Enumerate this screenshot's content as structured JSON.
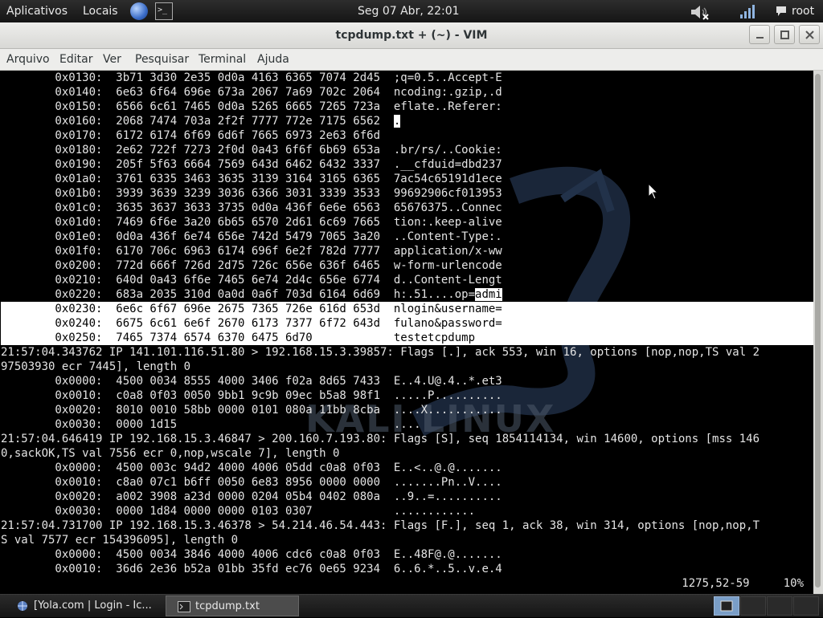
{
  "top_panel": {
    "applications": "Aplicativos",
    "places": "Locais",
    "clock": "Seg 07 Abr, 22:01",
    "user": "root",
    "launchers": [
      {
        "icon": "globe-icon"
      },
      {
        "icon": "terminal-icon"
      }
    ]
  },
  "window": {
    "title": "tcpdump.txt + (~) - VIM"
  },
  "menu": [
    "Arquivo",
    "Editar",
    "Ver",
    "Pesquisar",
    "Terminal",
    "Ajuda"
  ],
  "terminal": {
    "lines": [
      [
        {
          "t": "        0x0130:  3b71 3d30 2e35 0d0a 4163 6365 7074 2d45  ;q=0.5..Accept-E"
        }
      ],
      [
        {
          "t": "        0x0140:  6e63 6f64 696e 673a 2067 7a69 702c 2064  ncoding:.gzip,.d"
        }
      ],
      [
        {
          "t": "        0x0150:  6566 6c61 7465 0d0a 5265 6665 7265 723a  eflate..Referer:"
        }
      ],
      [
        {
          "t": "        0x0160:  2068 7474 703a 2f2f 7777 772e 7175 6562  "
        },
        {
          "t": ".",
          "c": "cursor"
        }
      ],
      [
        {
          "t": "        0x0170:  6172 6174 6f69 6d6f 7665 6973 2e63 6f6d"
        }
      ],
      [
        {
          "t": "        0x0180:  2e62 722f 7273 2f0d 0a43 6f6f 6b69 653a  .br/rs/..Cookie:"
        }
      ],
      [
        {
          "t": "        0x0190:  205f 5f63 6664 7569 643d 6462 6432 3337  .__cfduid=dbd237"
        }
      ],
      [
        {
          "t": "        0x01a0:  3761 6335 3463 3635 3139 3164 3165 6365  7ac54c65191d1ece"
        }
      ],
      [
        {
          "t": "        0x01b0:  3939 3639 3239 3036 6366 3031 3339 3533  99692906cf013953"
        }
      ],
      [
        {
          "t": "        0x01c0:  3635 3637 3633 3735 0d0a 436f 6e6e 6563  65676375..Connec"
        }
      ],
      [
        {
          "t": "        0x01d0:  7469 6f6e 3a20 6b65 6570 2d61 6c69 7665  tion:.keep-alive"
        }
      ],
      [
        {
          "t": "        0x01e0:  0d0a 436f 6e74 656e 742d 5479 7065 3a20  ..Content-Type:."
        }
      ],
      [
        {
          "t": "        0x01f0:  6170 706c 6963 6174 696f 6e2f 782d 7777  application/x-ww"
        }
      ],
      [
        {
          "t": "        0x0200:  772d 666f 726d 2d75 726c 656e 636f 6465  w-form-urlencode"
        }
      ],
      [
        {
          "t": "        0x0210:  640d 0a43 6f6e 7465 6e74 2d4c 656e 6774  d..Content-Lengt"
        }
      ],
      [
        {
          "t": "        0x0220:  683a 2035 310d 0a0d 0a6f 703d 6164 6d69  h:.51....op="
        },
        {
          "t": "admi",
          "c": "seg-hl"
        }
      ],
      [
        {
          "t": "        0x0230:  6e6c 6f67 696e 2675 7365 726e 616d 653d  nlogin&username="
        }
      ],
      [
        {
          "t": "        0x0240:  6675 6c61 6e6f 2670 6173 7377 6f72 643d  fulano&password="
        }
      ],
      [
        {
          "t": "        0x0250:  7465 7374 6574 6370 6475 6d70            testetcpdump"
        }
      ],
      [
        {
          "t": "21:57:04.343762 IP 141.101.116.51.80 > 192.168.15.3.39857: Flags [.], ack 553, win 16, options [nop,nop,TS val 2"
        }
      ],
      [
        {
          "t": "97503930 ecr 7445], length 0"
        }
      ],
      [
        {
          "t": "        0x0000:  4500 0034 8555 4000 3406 f02a 8d65 7433  E..4.U@.4..*.et3"
        }
      ],
      [
        {
          "t": "        0x0010:  c0a8 0f03 0050 9bb1 9c9b 09ec b5a8 98f1  .....P.........."
        }
      ],
      [
        {
          "t": "        0x0020:  8010 0010 58bb 0000 0101 080a 11bb 8cba  ....X..........."
        }
      ],
      [
        {
          "t": "        0x0030:  0000 1d15                                ...."
        }
      ],
      [
        {
          "t": "21:57:04.646419 IP 192.168.15.3.46847 > 200.160.7.193.80: Flags [S], seq 1854114134, win 14600, options [mss 146"
        }
      ],
      [
        {
          "t": "0,sackOK,TS val 7556 ecr 0,nop,wscale 7], length 0"
        }
      ],
      [
        {
          "t": "        0x0000:  4500 003c 94d2 4000 4006 05dd c0a8 0f03  E..<..@.@......."
        }
      ],
      [
        {
          "t": "        0x0010:  c8a0 07c1 b6ff 0050 6e83 8956 0000 0000  .......Pn..V...."
        }
      ],
      [
        {
          "t": "        0x0020:  a002 3908 a23d 0000 0204 05b4 0402 080a  ..9..=.........."
        }
      ],
      [
        {
          "t": "        0x0030:  0000 1d84 0000 0000 0103 0307            ............"
        }
      ],
      [
        {
          "t": "21:57:04.731700 IP 192.168.15.3.46378 > 54.214.46.54.443: Flags [F.], seq 1, ack 38, win 314, options [nop,nop,T"
        }
      ],
      [
        {
          "t": "S val 7577 ecr 154396095], length 0"
        }
      ],
      [
        {
          "t": "        0x0000:  4500 0034 3846 4000 4006 cdc6 c0a8 0f03  E..48F@.@......."
        }
      ],
      [
        {
          "t": "        0x0010:  36d6 2e36 b52a 01bb 35fd ec76 0e65 9234  6..6.*..5..v.e.4"
        }
      ]
    ],
    "highlight_rows": [
      16,
      17,
      18
    ],
    "status": "1275,52-59     10%"
  },
  "taskbar": {
    "tasks": [
      {
        "label": "[Yola.com | Login - Ic...",
        "icon": "browser-icon",
        "active": false
      },
      {
        "label": "tcpdump.txt",
        "icon": "terminal-icon",
        "active": true
      }
    ],
    "workspaces": 4
  },
  "colors": {
    "highlight": "#ffffff",
    "text": "#e4e4e4",
    "workspace_active": "#7a9ec7"
  }
}
